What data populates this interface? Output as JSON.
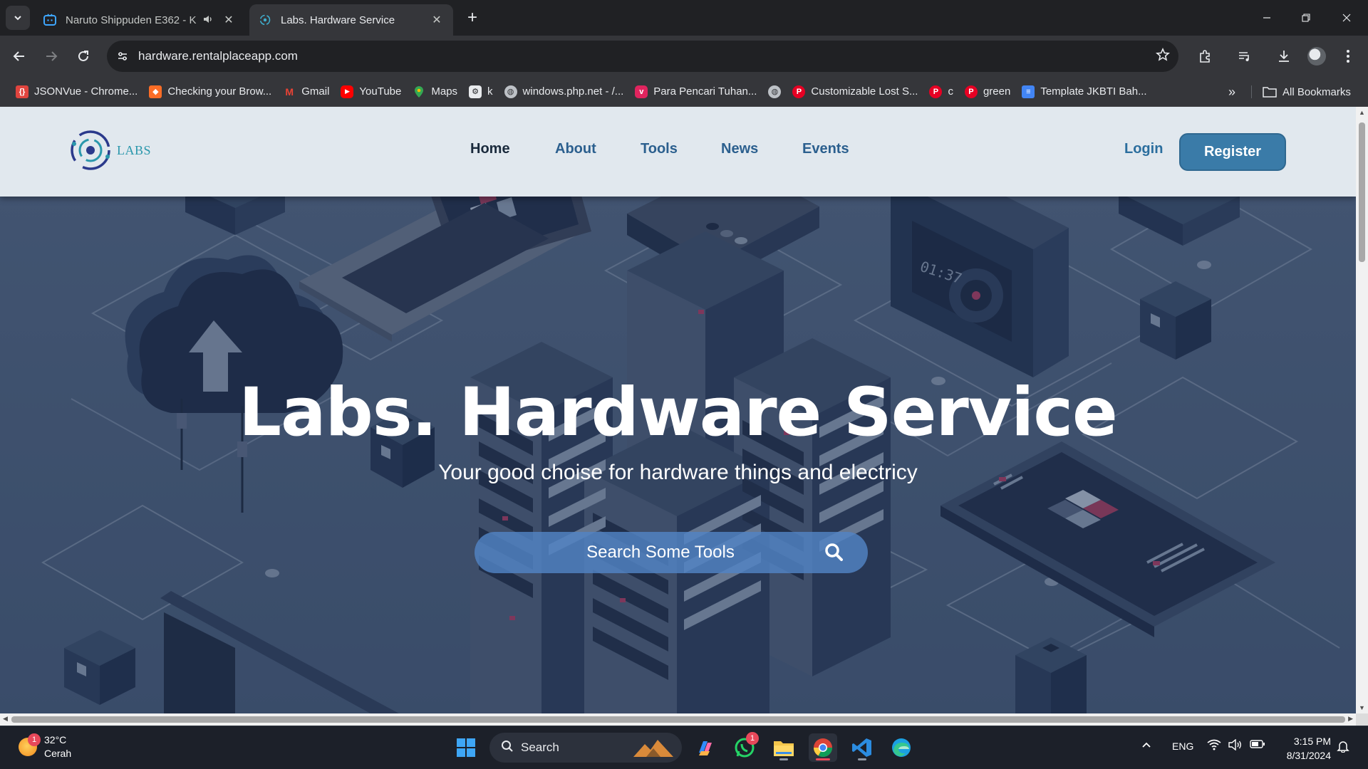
{
  "browser": {
    "tabs": [
      {
        "title": "Naruto Shippuden E362 - K",
        "active": false,
        "playing_audio": true
      },
      {
        "title": "Labs. Hardware Service",
        "active": true,
        "playing_audio": false
      }
    ],
    "address": "hardware.rentalplaceapp.com",
    "bookmarks": [
      {
        "label": "JSONVue - Chrome...",
        "icon": "jsonvue-icon",
        "color": "#e0443e"
      },
      {
        "label": "Checking your Brow...",
        "icon": "gitlab-icon",
        "color": "#fc6d26"
      },
      {
        "label": "Gmail",
        "icon": "gmail-icon",
        "color": "#ea4335"
      },
      {
        "label": "YouTube",
        "icon": "youtube-icon",
        "color": "#ff0000"
      },
      {
        "label": "Maps",
        "icon": "maps-icon",
        "color": "#34a853"
      },
      {
        "label": "k",
        "icon": "openai-icon",
        "color": "#e8eaed"
      },
      {
        "label": "windows.php.net - /...",
        "icon": "globe-icon",
        "color": "#bdc1c6"
      },
      {
        "label": "Para Pencari Tuhan...",
        "icon": "vidio-icon",
        "color": "#e0245e"
      },
      {
        "label": "",
        "icon": "globe-icon",
        "color": "#bdc1c6"
      },
      {
        "label": "Customizable Lost S...",
        "icon": "pinterest-icon",
        "color": "#e60023"
      },
      {
        "label": "c",
        "icon": "pinterest-icon",
        "color": "#e60023"
      },
      {
        "label": "green",
        "icon": "pinterest-icon",
        "color": "#e60023"
      },
      {
        "label": "Template JKBTI Bah...",
        "icon": "docs-icon",
        "color": "#4285f4"
      }
    ],
    "all_bookmarks_label": "All Bookmarks"
  },
  "site": {
    "logo_text": "LABS",
    "nav": [
      {
        "label": "Home",
        "active": true
      },
      {
        "label": "About",
        "active": false
      },
      {
        "label": "Tools",
        "active": false
      },
      {
        "label": "News",
        "active": false
      },
      {
        "label": "Events",
        "active": false
      }
    ],
    "login_label": "Login",
    "register_label": "Register",
    "hero_title": "Labs. Hardware Service",
    "hero_subtitle": "Your good choise for hardware things and electricy",
    "search_placeholder": "Search Some Tools",
    "colors": {
      "nav_bg": "#e1e8ee",
      "nav_link": "#2b5f8e",
      "register_bg": "#3a7ba8",
      "logo_accent": "#2a97ac"
    }
  },
  "taskbar": {
    "weather_temp": "32°C",
    "weather_desc": "Cerah",
    "weather_badge": "1",
    "search_label": "Search",
    "whatsapp_badge": "1",
    "language": "ENG",
    "time": "3:15 PM",
    "date": "8/31/2024"
  }
}
